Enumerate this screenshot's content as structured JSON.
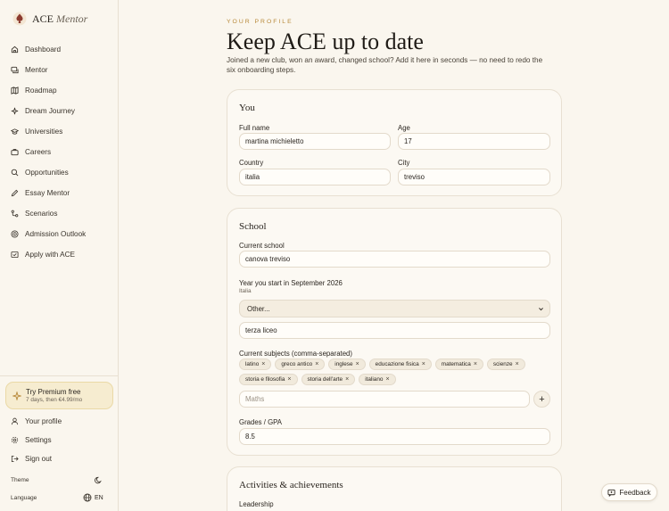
{
  "brand": {
    "name": "ACE",
    "name_em": "Mentor"
  },
  "nav": [
    {
      "label": "Dashboard",
      "icon": "home-icon"
    },
    {
      "label": "Mentor",
      "icon": "chat-icon"
    },
    {
      "label": "Roadmap",
      "icon": "map-icon"
    },
    {
      "label": "Dream Journey",
      "icon": "sparkle-icon"
    },
    {
      "label": "Universities",
      "icon": "graduation-icon"
    },
    {
      "label": "Careers",
      "icon": "briefcase-icon"
    },
    {
      "label": "Opportunities",
      "icon": "search-icon"
    },
    {
      "label": "Essay Mentor",
      "icon": "pen-icon"
    },
    {
      "label": "Scenarios",
      "icon": "branch-icon"
    },
    {
      "label": "Admission Outlook",
      "icon": "target-icon"
    },
    {
      "label": "Apply with ACE",
      "icon": "apply-icon"
    }
  ],
  "premium": {
    "title": "Try Premium free",
    "subtitle": "7 days, then €4.99/mo"
  },
  "bottom": {
    "profile": "Your profile",
    "settings": "Settings",
    "signout": "Sign out",
    "theme": "Theme",
    "language": "Language",
    "lang_value": "EN"
  },
  "header": {
    "eyebrow": "YOUR PROFILE",
    "title": "Keep ACE up to date",
    "lead": "Joined a new club, won an award, changed school? Add it here in seconds — no need to redo the six onboarding steps."
  },
  "you": {
    "title": "You",
    "full_name_label": "Full name",
    "full_name": "martina michieletto",
    "age_label": "Age",
    "age": "17",
    "country_label": "Country",
    "country": "italia",
    "city_label": "City",
    "city": "treviso"
  },
  "school": {
    "title": "School",
    "current_school_label": "Current school",
    "current_school": "canova treviso",
    "year_label": "Year you start in September 2026",
    "year_sub": "Italia",
    "year_select": "Other...",
    "year_other": "terza liceo",
    "subjects_label": "Current subjects (comma-separated)",
    "subjects": [
      "latino",
      "greco antico",
      "inglese",
      "educazione fisica",
      "matematica",
      "scienze",
      "storia e filosofia",
      "storia dell'arte",
      "italiano"
    ],
    "subject_placeholder": "Maths",
    "grades_label": "Grades / GPA",
    "grades": "8.5"
  },
  "activities": {
    "title": "Activities & achievements",
    "leadership_label": "Leadership"
  },
  "feedback": "Feedback",
  "colors": {
    "accent": "#b8893a",
    "background": "#faf6ee",
    "premium_bg": "#f6ecd0"
  }
}
